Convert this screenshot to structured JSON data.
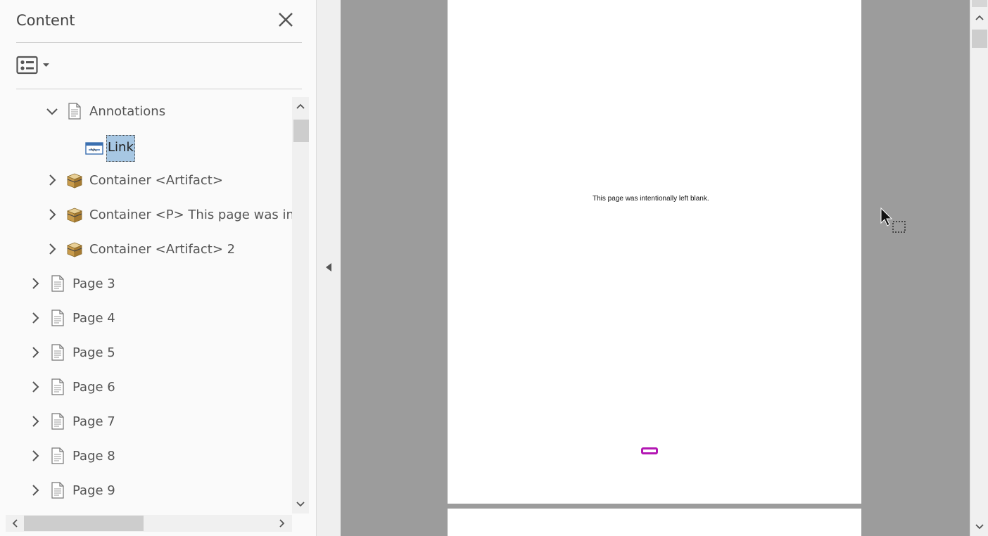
{
  "panel": {
    "title": "Content",
    "close_icon": "close-icon",
    "options_icon": "list-options-icon"
  },
  "tree": {
    "items": [
      {
        "label": "Annotations",
        "icon": "page-icon",
        "chevron": "expanded"
      },
      {
        "label": "Link",
        "icon": "link-annotation-icon",
        "chevron": "none",
        "selected": true
      },
      {
        "label": "Container <Artifact>",
        "icon": "container-box-icon",
        "chevron": "collapsed"
      },
      {
        "label": "Container <P> This page was intentionally left blank.",
        "icon": "container-box-icon",
        "chevron": "collapsed"
      },
      {
        "label": "Container <Artifact> 2",
        "icon": "container-box-icon",
        "chevron": "collapsed"
      },
      {
        "label": "Page 3",
        "icon": "page-icon",
        "chevron": "collapsed"
      },
      {
        "label": "Page 4",
        "icon": "page-icon",
        "chevron": "collapsed"
      },
      {
        "label": "Page 5",
        "icon": "page-icon",
        "chevron": "collapsed"
      },
      {
        "label": "Page 6",
        "icon": "page-icon",
        "chevron": "collapsed"
      },
      {
        "label": "Page 7",
        "icon": "page-icon",
        "chevron": "collapsed"
      },
      {
        "label": "Page 8",
        "icon": "page-icon",
        "chevron": "collapsed"
      },
      {
        "label": "Page 9",
        "icon": "page-icon",
        "chevron": "collapsed"
      }
    ]
  },
  "document": {
    "page_text": "This page was intentionally left blank.",
    "link_mark_color": "#b317b3"
  },
  "colors": {
    "selection": "#a7c7e3",
    "doc_background": "#9c9c9c"
  }
}
